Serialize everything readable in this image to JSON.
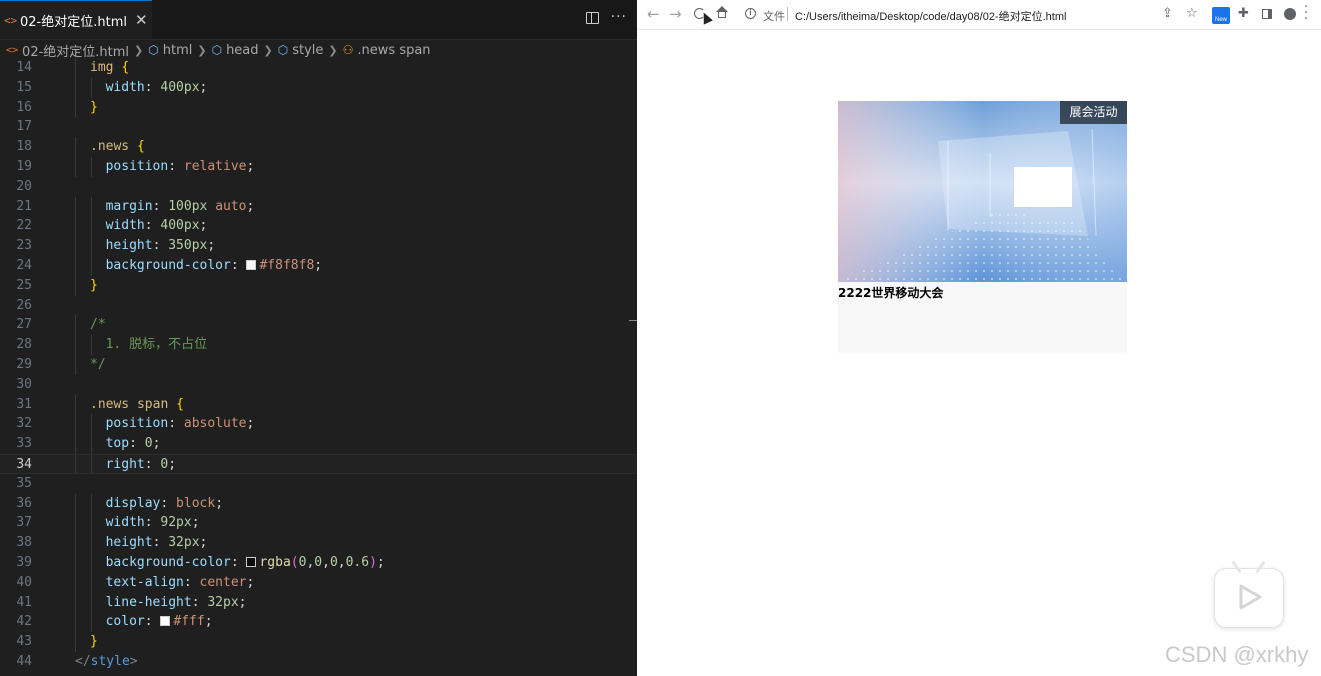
{
  "editor": {
    "tab": {
      "icon": "<>",
      "title": "02-绝对定位.html"
    },
    "breadcrumb": [
      "02-绝对定位.html",
      "html",
      "head",
      "style",
      ".news span"
    ],
    "lines": [
      {
        "n": "14",
        "indent": 1,
        "tokens": [
          [
            "sel",
            "img"
          ],
          [
            "plain",
            " "
          ],
          [
            "brace",
            "{"
          ]
        ]
      },
      {
        "n": "15",
        "indent": 2,
        "tokens": [
          [
            "prop",
            "width"
          ],
          [
            "plain",
            ": "
          ],
          [
            "num",
            "400px"
          ],
          [
            "plain",
            ";"
          ]
        ]
      },
      {
        "n": "16",
        "indent": 1,
        "tokens": [
          [
            "brace",
            "}"
          ]
        ]
      },
      {
        "n": "17",
        "indent": 0,
        "tokens": []
      },
      {
        "n": "18",
        "indent": 1,
        "tokens": [
          [
            "sel",
            ".news"
          ],
          [
            "plain",
            " "
          ],
          [
            "brace",
            "{"
          ]
        ]
      },
      {
        "n": "19",
        "indent": 2,
        "tokens": [
          [
            "prop",
            "position"
          ],
          [
            "plain",
            ": "
          ],
          [
            "val",
            "relative"
          ],
          [
            "plain",
            ";"
          ]
        ]
      },
      {
        "n": "20",
        "indent": 0,
        "tokens": []
      },
      {
        "n": "21",
        "indent": 2,
        "tokens": [
          [
            "prop",
            "margin"
          ],
          [
            "plain",
            ": "
          ],
          [
            "num",
            "100px"
          ],
          [
            "plain",
            " "
          ],
          [
            "val",
            "auto"
          ],
          [
            "plain",
            ";"
          ]
        ]
      },
      {
        "n": "22",
        "indent": 2,
        "tokens": [
          [
            "prop",
            "width"
          ],
          [
            "plain",
            ": "
          ],
          [
            "num",
            "400px"
          ],
          [
            "plain",
            ";"
          ]
        ]
      },
      {
        "n": "23",
        "indent": 2,
        "tokens": [
          [
            "prop",
            "height"
          ],
          [
            "plain",
            ": "
          ],
          [
            "num",
            "350px"
          ],
          [
            "plain",
            ";"
          ]
        ]
      },
      {
        "n": "24",
        "indent": 2,
        "tokens": [
          [
            "prop",
            "background-color"
          ],
          [
            "plain",
            ": "
          ],
          [
            "swatch",
            "#f8f8f8"
          ],
          [
            "val",
            "#f8f8f8"
          ],
          [
            "plain",
            ";"
          ]
        ]
      },
      {
        "n": "25",
        "indent": 1,
        "tokens": [
          [
            "brace",
            "}"
          ]
        ]
      },
      {
        "n": "26",
        "indent": 0,
        "tokens": []
      },
      {
        "n": "27",
        "indent": 1,
        "tokens": [
          [
            "com",
            "/*"
          ]
        ]
      },
      {
        "n": "28",
        "indent": 2,
        "tokens": [
          [
            "com",
            "1. 脱标，不占位"
          ]
        ]
      },
      {
        "n": "29",
        "indent": 1,
        "tokens": [
          [
            "com",
            "*/"
          ]
        ]
      },
      {
        "n": "30",
        "indent": 0,
        "tokens": []
      },
      {
        "n": "31",
        "indent": 1,
        "tokens": [
          [
            "sel",
            ".news span"
          ],
          [
            "plain",
            " "
          ],
          [
            "brace",
            "{"
          ]
        ]
      },
      {
        "n": "32",
        "indent": 2,
        "tokens": [
          [
            "prop",
            "position"
          ],
          [
            "plain",
            ": "
          ],
          [
            "val",
            "absolute"
          ],
          [
            "plain",
            ";"
          ]
        ]
      },
      {
        "n": "33",
        "indent": 2,
        "tokens": [
          [
            "prop",
            "top"
          ],
          [
            "plain",
            ": "
          ],
          [
            "num",
            "0"
          ],
          [
            "plain",
            ";"
          ]
        ]
      },
      {
        "n": "34",
        "indent": 2,
        "current": true,
        "tokens": [
          [
            "prop",
            "right"
          ],
          [
            "plain",
            ": "
          ],
          [
            "num",
            "0"
          ],
          [
            "plain",
            ";"
          ]
        ]
      },
      {
        "n": "35",
        "indent": 0,
        "tokens": []
      },
      {
        "n": "36",
        "indent": 2,
        "tokens": [
          [
            "prop",
            "display"
          ],
          [
            "plain",
            ": "
          ],
          [
            "val",
            "block"
          ],
          [
            "plain",
            ";"
          ]
        ]
      },
      {
        "n": "37",
        "indent": 2,
        "tokens": [
          [
            "prop",
            "width"
          ],
          [
            "plain",
            ": "
          ],
          [
            "num",
            "92px"
          ],
          [
            "plain",
            ";"
          ]
        ]
      },
      {
        "n": "38",
        "indent": 2,
        "tokens": [
          [
            "prop",
            "height"
          ],
          [
            "plain",
            ": "
          ],
          [
            "num",
            "32px"
          ],
          [
            "plain",
            ";"
          ]
        ]
      },
      {
        "n": "39",
        "indent": 2,
        "tokens": [
          [
            "prop",
            "background-color"
          ],
          [
            "plain",
            ": "
          ],
          [
            "swatch",
            "rgba(0,0,0,0.6)"
          ],
          [
            "fn",
            "rgba"
          ],
          [
            "par",
            "("
          ],
          [
            "num",
            "0"
          ],
          [
            "plain",
            ","
          ],
          [
            "num",
            "0"
          ],
          [
            "plain",
            ","
          ],
          [
            "num",
            "0"
          ],
          [
            "plain",
            ","
          ],
          [
            "num",
            "0.6"
          ],
          [
            "par",
            ")"
          ],
          [
            "plain",
            ";"
          ]
        ]
      },
      {
        "n": "40",
        "indent": 2,
        "tokens": [
          [
            "prop",
            "text-align"
          ],
          [
            "plain",
            ": "
          ],
          [
            "val",
            "center"
          ],
          [
            "plain",
            ";"
          ]
        ]
      },
      {
        "n": "41",
        "indent": 2,
        "tokens": [
          [
            "prop",
            "line-height"
          ],
          [
            "plain",
            ": "
          ],
          [
            "num",
            "32px"
          ],
          [
            "plain",
            ";"
          ]
        ]
      },
      {
        "n": "42",
        "indent": 2,
        "tokens": [
          [
            "prop",
            "color"
          ],
          [
            "plain",
            ": "
          ],
          [
            "swatch",
            "#fff"
          ],
          [
            "val",
            "#fff"
          ],
          [
            "plain",
            ";"
          ]
        ]
      },
      {
        "n": "43",
        "indent": 1,
        "tokens": [
          [
            "brace",
            "}"
          ]
        ]
      },
      {
        "n": "44",
        "indent": 0,
        "tokens": [
          [
            "tag",
            "</"
          ],
          [
            "tagn",
            "style"
          ],
          [
            "tag",
            ">"
          ]
        ]
      }
    ]
  },
  "browser": {
    "protocol_label": "文件",
    "address": "C:/Users/itheima/Desktop/code/day08/02-绝对定位.html",
    "new_badge": "New",
    "news": {
      "tag": "展会活动",
      "title": "2222世界移动大会"
    },
    "watermark": "CSDN @xrkhy"
  },
  "colors": {
    "accent": "#0078d4",
    "news_background": "#f8f8f8",
    "tag_background": "rgba(0,0,0,0.6)"
  }
}
